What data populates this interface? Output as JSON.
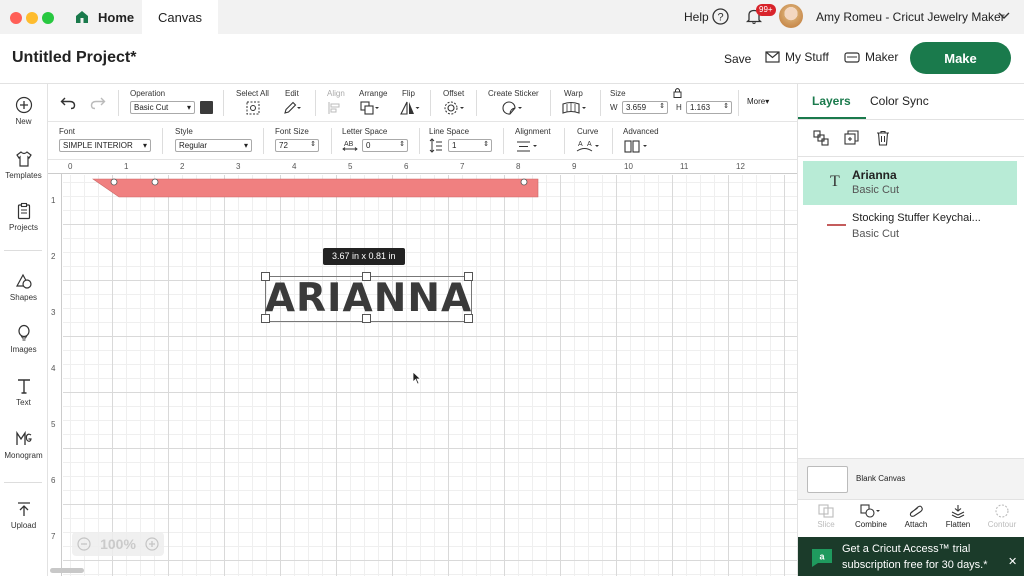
{
  "titlebar": {
    "home_label": "Home",
    "canvas_tab": "Canvas",
    "help_label": "Help",
    "notif_count": "99+",
    "user_name": "Amy Romeu - Cricut Jewelry Maker"
  },
  "header": {
    "project_title": "Untitled Project*",
    "save": "Save",
    "my_stuff": "My Stuff",
    "machine": "Maker",
    "make": "Make"
  },
  "toolbar": {
    "operation_label": "Operation",
    "operation_value": "Basic Cut",
    "select_all": "Select All",
    "edit": "Edit",
    "align": "Align",
    "arrange": "Arrange",
    "flip": "Flip",
    "offset": "Offset",
    "create_sticker": "Create Sticker",
    "warp": "Warp",
    "size": "Size",
    "w_label": "W",
    "w_value": "3.659",
    "h_label": "H",
    "h_value": "1.163",
    "more": "More"
  },
  "text_toolbar": {
    "font_label": "Font",
    "font_value": "SIMPLE INTERIOR",
    "style_label": "Style",
    "style_value": "Regular",
    "font_size_label": "Font Size",
    "font_size_value": "72",
    "letter_space_label": "Letter Space",
    "letter_space_value": "0",
    "line_space_label": "Line Space",
    "line_space_value": "1",
    "alignment_label": "Alignment",
    "curve_label": "Curve",
    "advanced_label": "Advanced"
  },
  "sidebar": {
    "items": [
      {
        "label": "New",
        "icon": "plus-icon"
      },
      {
        "label": "Templates",
        "icon": "shirt-icon"
      },
      {
        "label": "Projects",
        "icon": "clipboard-icon"
      },
      {
        "label": "Shapes",
        "icon": "shapes-icon"
      },
      {
        "label": "Images",
        "icon": "balloon-icon"
      },
      {
        "label": "Text",
        "icon": "text-icon"
      },
      {
        "label": "Monogram",
        "icon": "monogram-icon"
      },
      {
        "label": "Upload",
        "icon": "upload-icon"
      }
    ]
  },
  "canvas": {
    "ruler_top": [
      "0",
      "1",
      "2",
      "3",
      "4",
      "5",
      "6",
      "7",
      "8",
      "9",
      "10",
      "11",
      "12"
    ],
    "ruler_left": [
      "1",
      "2",
      "3",
      "4",
      "5",
      "6",
      "7"
    ],
    "size_tooltip": "3.67  in x 0.81  in",
    "text_object": "ARIANNA",
    "zoom": "100%",
    "colors": {
      "banner": "#f08080",
      "text": "#3a3a3a",
      "grid_major": "#d9d9d9"
    }
  },
  "panel": {
    "tabs": [
      "Layers",
      "Color Sync"
    ],
    "layers": [
      {
        "name": "Arianna",
        "op": "Basic Cut",
        "selected": true
      },
      {
        "name": "Stocking Stuffer Keychai...",
        "op": "Basic Cut",
        "selected": false
      }
    ],
    "blank_canvas": "Blank Canvas",
    "actions": [
      "Slice",
      "Combine",
      "Attach",
      "Flatten",
      "Contour"
    ],
    "access_line1": "Get a Cricut Access™ trial",
    "access_line2": "subscription free for 30 days.*",
    "colors": {
      "accent": "#1a7a4c",
      "selected_layer": "#b8ebd6",
      "access_bg": "#1b3b2a"
    }
  }
}
